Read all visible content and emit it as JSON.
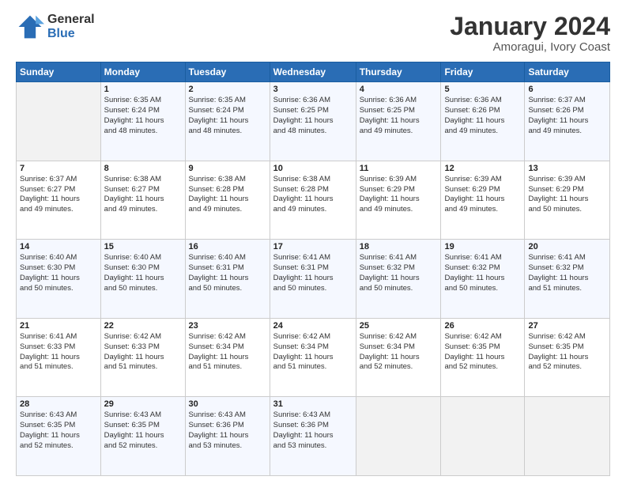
{
  "header": {
    "logo_general": "General",
    "logo_blue": "Blue",
    "title": "January 2024",
    "subtitle": "Amoragui, Ivory Coast"
  },
  "columns": [
    "Sunday",
    "Monday",
    "Tuesday",
    "Wednesday",
    "Thursday",
    "Friday",
    "Saturday"
  ],
  "weeks": [
    [
      {
        "day": "",
        "info": ""
      },
      {
        "day": "1",
        "info": "Sunrise: 6:35 AM\nSunset: 6:24 PM\nDaylight: 11 hours\nand 48 minutes."
      },
      {
        "day": "2",
        "info": "Sunrise: 6:35 AM\nSunset: 6:24 PM\nDaylight: 11 hours\nand 48 minutes."
      },
      {
        "day": "3",
        "info": "Sunrise: 6:36 AM\nSunset: 6:25 PM\nDaylight: 11 hours\nand 48 minutes."
      },
      {
        "day": "4",
        "info": "Sunrise: 6:36 AM\nSunset: 6:25 PM\nDaylight: 11 hours\nand 49 minutes."
      },
      {
        "day": "5",
        "info": "Sunrise: 6:36 AM\nSunset: 6:26 PM\nDaylight: 11 hours\nand 49 minutes."
      },
      {
        "day": "6",
        "info": "Sunrise: 6:37 AM\nSunset: 6:26 PM\nDaylight: 11 hours\nand 49 minutes."
      }
    ],
    [
      {
        "day": "7",
        "info": "Sunrise: 6:37 AM\nSunset: 6:27 PM\nDaylight: 11 hours\nand 49 minutes."
      },
      {
        "day": "8",
        "info": "Sunrise: 6:38 AM\nSunset: 6:27 PM\nDaylight: 11 hours\nand 49 minutes."
      },
      {
        "day": "9",
        "info": "Sunrise: 6:38 AM\nSunset: 6:28 PM\nDaylight: 11 hours\nand 49 minutes."
      },
      {
        "day": "10",
        "info": "Sunrise: 6:38 AM\nSunset: 6:28 PM\nDaylight: 11 hours\nand 49 minutes."
      },
      {
        "day": "11",
        "info": "Sunrise: 6:39 AM\nSunset: 6:29 PM\nDaylight: 11 hours\nand 49 minutes."
      },
      {
        "day": "12",
        "info": "Sunrise: 6:39 AM\nSunset: 6:29 PM\nDaylight: 11 hours\nand 49 minutes."
      },
      {
        "day": "13",
        "info": "Sunrise: 6:39 AM\nSunset: 6:29 PM\nDaylight: 11 hours\nand 50 minutes."
      }
    ],
    [
      {
        "day": "14",
        "info": "Sunrise: 6:40 AM\nSunset: 6:30 PM\nDaylight: 11 hours\nand 50 minutes."
      },
      {
        "day": "15",
        "info": "Sunrise: 6:40 AM\nSunset: 6:30 PM\nDaylight: 11 hours\nand 50 minutes."
      },
      {
        "day": "16",
        "info": "Sunrise: 6:40 AM\nSunset: 6:31 PM\nDaylight: 11 hours\nand 50 minutes."
      },
      {
        "day": "17",
        "info": "Sunrise: 6:41 AM\nSunset: 6:31 PM\nDaylight: 11 hours\nand 50 minutes."
      },
      {
        "day": "18",
        "info": "Sunrise: 6:41 AM\nSunset: 6:32 PM\nDaylight: 11 hours\nand 50 minutes."
      },
      {
        "day": "19",
        "info": "Sunrise: 6:41 AM\nSunset: 6:32 PM\nDaylight: 11 hours\nand 50 minutes."
      },
      {
        "day": "20",
        "info": "Sunrise: 6:41 AM\nSunset: 6:32 PM\nDaylight: 11 hours\nand 51 minutes."
      }
    ],
    [
      {
        "day": "21",
        "info": "Sunrise: 6:41 AM\nSunset: 6:33 PM\nDaylight: 11 hours\nand 51 minutes."
      },
      {
        "day": "22",
        "info": "Sunrise: 6:42 AM\nSunset: 6:33 PM\nDaylight: 11 hours\nand 51 minutes."
      },
      {
        "day": "23",
        "info": "Sunrise: 6:42 AM\nSunset: 6:34 PM\nDaylight: 11 hours\nand 51 minutes."
      },
      {
        "day": "24",
        "info": "Sunrise: 6:42 AM\nSunset: 6:34 PM\nDaylight: 11 hours\nand 51 minutes."
      },
      {
        "day": "25",
        "info": "Sunrise: 6:42 AM\nSunset: 6:34 PM\nDaylight: 11 hours\nand 52 minutes."
      },
      {
        "day": "26",
        "info": "Sunrise: 6:42 AM\nSunset: 6:35 PM\nDaylight: 11 hours\nand 52 minutes."
      },
      {
        "day": "27",
        "info": "Sunrise: 6:42 AM\nSunset: 6:35 PM\nDaylight: 11 hours\nand 52 minutes."
      }
    ],
    [
      {
        "day": "28",
        "info": "Sunrise: 6:43 AM\nSunset: 6:35 PM\nDaylight: 11 hours\nand 52 minutes."
      },
      {
        "day": "29",
        "info": "Sunrise: 6:43 AM\nSunset: 6:35 PM\nDaylight: 11 hours\nand 52 minutes."
      },
      {
        "day": "30",
        "info": "Sunrise: 6:43 AM\nSunset: 6:36 PM\nDaylight: 11 hours\nand 53 minutes."
      },
      {
        "day": "31",
        "info": "Sunrise: 6:43 AM\nSunset: 6:36 PM\nDaylight: 11 hours\nand 53 minutes."
      },
      {
        "day": "",
        "info": ""
      },
      {
        "day": "",
        "info": ""
      },
      {
        "day": "",
        "info": ""
      }
    ]
  ]
}
